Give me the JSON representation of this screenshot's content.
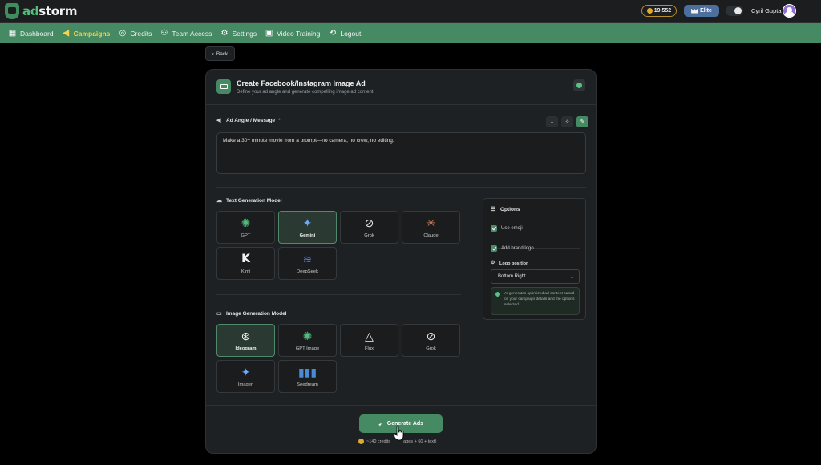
{
  "header": {
    "logo_prefix": "ad",
    "logo_suffix": "storm",
    "credits": "19,552",
    "plan": "Elite",
    "user_name": "Cyril Gupta"
  },
  "nav": {
    "items": [
      {
        "label": "Dashboard",
        "icon": "dashboard-icon"
      },
      {
        "label": "Campaigns",
        "icon": "megaphone-icon",
        "active": true
      },
      {
        "label": "Credits",
        "icon": "credits-icon"
      },
      {
        "label": "Team Access",
        "icon": "team-icon"
      },
      {
        "label": "Settings",
        "icon": "gear-icon"
      },
      {
        "label": "Video Training",
        "icon": "video-icon"
      },
      {
        "label": "Logout",
        "icon": "logout-icon"
      }
    ]
  },
  "back_label": "Back",
  "card": {
    "title": "Create Facebook/Instagram Image Ad",
    "subtitle": "Define your ad angle and generate compelling image ad content"
  },
  "angle": {
    "label": "Ad Angle / Message",
    "required_mark": "*",
    "value": "Make a 30+ minute movie from a prompt—no camera, no crew, no editing."
  },
  "text_models": {
    "label": "Text Generation Model",
    "items": [
      {
        "name": "GPT",
        "selected": false
      },
      {
        "name": "Gemini",
        "selected": true
      },
      {
        "name": "Grok",
        "selected": false
      },
      {
        "name": "Claude",
        "selected": false
      },
      {
        "name": "Kimi",
        "selected": false
      },
      {
        "name": "DeepSeek",
        "selected": false
      }
    ]
  },
  "image_models": {
    "label": "Image Generation Model",
    "items": [
      {
        "name": "Ideogram",
        "selected": true
      },
      {
        "name": "GPT Image",
        "selected": false
      },
      {
        "name": "Flux",
        "selected": false
      },
      {
        "name": "Grok",
        "selected": false
      },
      {
        "name": "Imagen",
        "selected": false
      },
      {
        "name": "Seedream",
        "selected": false
      }
    ]
  },
  "options": {
    "title": "Options",
    "use_emoji": "Use emoji",
    "use_emoji_checked": true,
    "add_brand_logo": "Add brand logo",
    "add_brand_logo_checked": true,
    "logo_position_label": "Logo position",
    "logo_position_value": "Bottom Right",
    "info_text": "AI generates optimized ad content based on your campaign details and the options selected."
  },
  "footer": {
    "generate_label": "Generate Ads",
    "cost_prefix": "~140 credits",
    "cost_suffix": "ages + 60 + text)"
  },
  "colors": {
    "accent": "#468a64",
    "active_nav": "#f6d34a",
    "background": "#000000",
    "card": "#1e2124"
  }
}
